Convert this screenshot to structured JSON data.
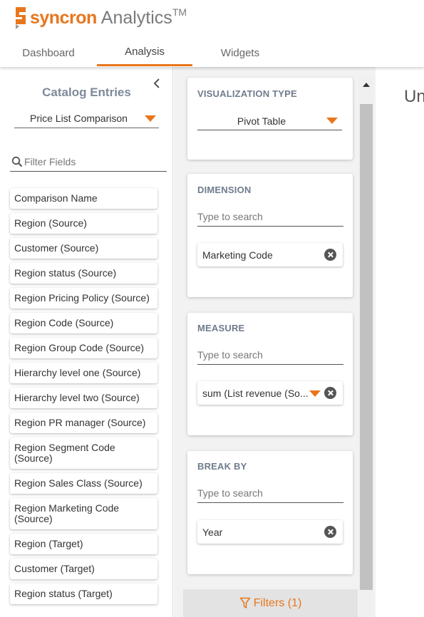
{
  "app": {
    "brand": "syncron",
    "product": "Analytics",
    "trademark": "TM",
    "colors": {
      "accent": "#e8761c",
      "title_gray": "#7d8a99"
    }
  },
  "tabs": [
    {
      "label": "Dashboard",
      "active": false
    },
    {
      "label": "Analysis",
      "active": true
    },
    {
      "label": "Widgets",
      "active": false
    }
  ],
  "catalog": {
    "title": "Catalog Entries",
    "selected_source": "Price List Comparison",
    "filter_placeholder": "Filter Fields",
    "fields": [
      "Comparison Name",
      "Region (Source)",
      "Customer (Source)",
      "Region status (Source)",
      "Region Pricing Policy (Source)",
      "Region Code (Source)",
      "Region Group Code (Source)",
      "Hierarchy level one (Source)",
      "Hierarchy level two (Source)",
      "Region PR manager (Source)",
      "Region Segment Code (Source)",
      "Region Sales Class (Source)",
      "Region Marketing Code (Source)",
      "Region (Target)",
      "Customer (Target)",
      "Region status (Target)"
    ]
  },
  "config": {
    "visualization": {
      "title": "VISUALIZATION TYPE",
      "value": "Pivot Table"
    },
    "dimension": {
      "title": "DIMENSION",
      "placeholder": "Type to search",
      "chip": "Marketing Code"
    },
    "measure": {
      "title": "MEASURE",
      "placeholder": "Type to search",
      "chip": "sum (List revenue (So..."
    },
    "break_by": {
      "title": "BREAK BY",
      "placeholder": "Type to search",
      "chip": "Year"
    },
    "filters_label": "Filters (1)"
  },
  "preview": {
    "title_fragment": "Un"
  }
}
